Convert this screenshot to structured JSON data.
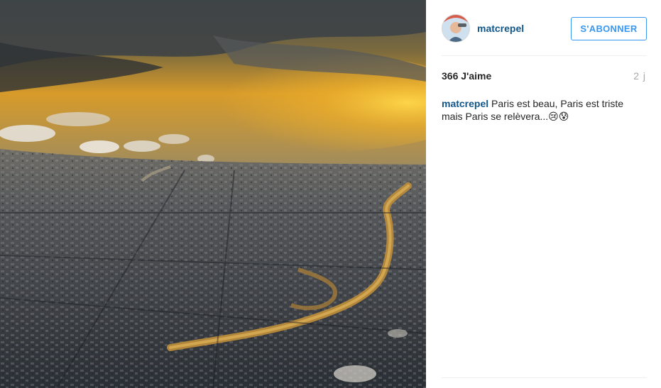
{
  "post": {
    "author": "matcrepel",
    "follow_label": "S'ABONNER",
    "likes": "366 J'aime",
    "time": "2 j",
    "caption_user": "matcrepel",
    "caption_text": "Paris est beau, Paris est triste mais Paris se relèvera...",
    "caption_emojis": "😢😰"
  },
  "colors": {
    "username": "#125688",
    "follow_accent": "#3897f0",
    "time": "#a5a7aa"
  },
  "icons": {
    "avatar": "user-avatar"
  }
}
